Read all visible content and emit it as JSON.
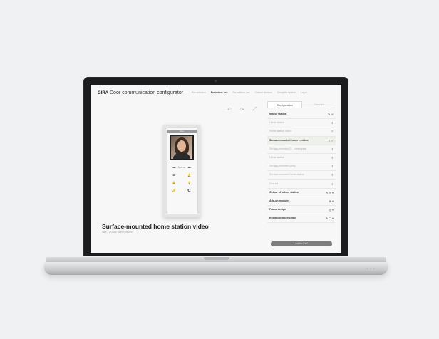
{
  "app": {
    "logo": "GIRA",
    "title": "Door communication configurator",
    "nav": [
      "Pre-selection",
      "For indoor use",
      "For outdoor use",
      "Custom devices",
      "Complete system",
      "Log in"
    ],
    "nav_active_index": 1
  },
  "toolbar": {
    "icons": [
      "undo-icon",
      "redo-icon",
      "fullscreen-icon"
    ]
  },
  "device": {
    "label": "Gira",
    "buttons": [
      "▬",
      "Menu",
      "▬",
      "☎",
      "",
      "🔔",
      "🔓",
      "",
      "💡",
      "🔑",
      "",
      "📞"
    ]
  },
  "selection": {
    "title": "Surface-mounted home station video",
    "subtitle": "Gira 2 | Home station device"
  },
  "panel": {
    "tabs": [
      "Configuration",
      "Overview"
    ],
    "active_tab": 0,
    "rows": [
      {
        "label": "Indoor station",
        "ctrl": "✎ ✕",
        "style": "bold"
      },
      {
        "label": "Home station",
        "ctrl": "⇕",
        "style": "dim"
      },
      {
        "label": "Home station video",
        "ctrl": "⇕",
        "style": "dim"
      },
      {
        "label": "Surface-mounted home ... video",
        "ctrl": "⇕ ✓",
        "style": "sel"
      },
      {
        "label": "Surface-mounted D... video plus",
        "ctrl": "⇕",
        "style": "dim"
      },
      {
        "label": "Home station",
        "ctrl": "⇕",
        "style": "dim"
      },
      {
        "label": "Surface-mounted gong",
        "ctrl": "⇕",
        "style": "dim"
      },
      {
        "label": "Surface-mounted home station",
        "ctrl": "⇕",
        "style": "dim"
      },
      {
        "label": "Gira ad.",
        "ctrl": "⇕",
        "style": "dim"
      },
      {
        "label": "Colour of indoor station",
        "ctrl": "✎ ✕ ▾",
        "style": "bold"
      },
      {
        "label": "Add-on modules",
        "ctrl": "⊕ ▾",
        "style": "bold"
      },
      {
        "label": "Frame design",
        "ctrl": "◎ ▾",
        "style": "bold"
      },
      {
        "label": "Room control monitor",
        "ctrl": "✎ ☐ ▾",
        "style": "bold"
      }
    ],
    "button": "Add to Cart"
  },
  "laptop": {
    "base_dots": "• • •"
  }
}
